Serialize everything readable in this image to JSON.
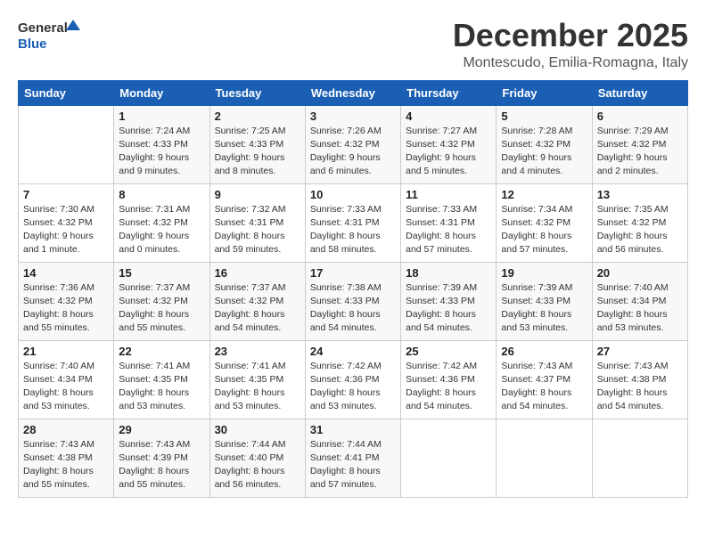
{
  "header": {
    "logo_line1": "General",
    "logo_line2": "Blue",
    "month": "December 2025",
    "location": "Montescudo, Emilia-Romagna, Italy"
  },
  "weekdays": [
    "Sunday",
    "Monday",
    "Tuesday",
    "Wednesday",
    "Thursday",
    "Friday",
    "Saturday"
  ],
  "weeks": [
    [
      {
        "day": "",
        "info": ""
      },
      {
        "day": "1",
        "info": "Sunrise: 7:24 AM\nSunset: 4:33 PM\nDaylight: 9 hours\nand 9 minutes."
      },
      {
        "day": "2",
        "info": "Sunrise: 7:25 AM\nSunset: 4:33 PM\nDaylight: 9 hours\nand 8 minutes."
      },
      {
        "day": "3",
        "info": "Sunrise: 7:26 AM\nSunset: 4:32 PM\nDaylight: 9 hours\nand 6 minutes."
      },
      {
        "day": "4",
        "info": "Sunrise: 7:27 AM\nSunset: 4:32 PM\nDaylight: 9 hours\nand 5 minutes."
      },
      {
        "day": "5",
        "info": "Sunrise: 7:28 AM\nSunset: 4:32 PM\nDaylight: 9 hours\nand 4 minutes."
      },
      {
        "day": "6",
        "info": "Sunrise: 7:29 AM\nSunset: 4:32 PM\nDaylight: 9 hours\nand 2 minutes."
      }
    ],
    [
      {
        "day": "7",
        "info": "Sunrise: 7:30 AM\nSunset: 4:32 PM\nDaylight: 9 hours\nand 1 minute."
      },
      {
        "day": "8",
        "info": "Sunrise: 7:31 AM\nSunset: 4:32 PM\nDaylight: 9 hours\nand 0 minutes."
      },
      {
        "day": "9",
        "info": "Sunrise: 7:32 AM\nSunset: 4:31 PM\nDaylight: 8 hours\nand 59 minutes."
      },
      {
        "day": "10",
        "info": "Sunrise: 7:33 AM\nSunset: 4:31 PM\nDaylight: 8 hours\nand 58 minutes."
      },
      {
        "day": "11",
        "info": "Sunrise: 7:33 AM\nSunset: 4:31 PM\nDaylight: 8 hours\nand 57 minutes."
      },
      {
        "day": "12",
        "info": "Sunrise: 7:34 AM\nSunset: 4:32 PM\nDaylight: 8 hours\nand 57 minutes."
      },
      {
        "day": "13",
        "info": "Sunrise: 7:35 AM\nSunset: 4:32 PM\nDaylight: 8 hours\nand 56 minutes."
      }
    ],
    [
      {
        "day": "14",
        "info": "Sunrise: 7:36 AM\nSunset: 4:32 PM\nDaylight: 8 hours\nand 55 minutes."
      },
      {
        "day": "15",
        "info": "Sunrise: 7:37 AM\nSunset: 4:32 PM\nDaylight: 8 hours\nand 55 minutes."
      },
      {
        "day": "16",
        "info": "Sunrise: 7:37 AM\nSunset: 4:32 PM\nDaylight: 8 hours\nand 54 minutes."
      },
      {
        "day": "17",
        "info": "Sunrise: 7:38 AM\nSunset: 4:33 PM\nDaylight: 8 hours\nand 54 minutes."
      },
      {
        "day": "18",
        "info": "Sunrise: 7:39 AM\nSunset: 4:33 PM\nDaylight: 8 hours\nand 54 minutes."
      },
      {
        "day": "19",
        "info": "Sunrise: 7:39 AM\nSunset: 4:33 PM\nDaylight: 8 hours\nand 53 minutes."
      },
      {
        "day": "20",
        "info": "Sunrise: 7:40 AM\nSunset: 4:34 PM\nDaylight: 8 hours\nand 53 minutes."
      }
    ],
    [
      {
        "day": "21",
        "info": "Sunrise: 7:40 AM\nSunset: 4:34 PM\nDaylight: 8 hours\nand 53 minutes."
      },
      {
        "day": "22",
        "info": "Sunrise: 7:41 AM\nSunset: 4:35 PM\nDaylight: 8 hours\nand 53 minutes."
      },
      {
        "day": "23",
        "info": "Sunrise: 7:41 AM\nSunset: 4:35 PM\nDaylight: 8 hours\nand 53 minutes."
      },
      {
        "day": "24",
        "info": "Sunrise: 7:42 AM\nSunset: 4:36 PM\nDaylight: 8 hours\nand 53 minutes."
      },
      {
        "day": "25",
        "info": "Sunrise: 7:42 AM\nSunset: 4:36 PM\nDaylight: 8 hours\nand 54 minutes."
      },
      {
        "day": "26",
        "info": "Sunrise: 7:43 AM\nSunset: 4:37 PM\nDaylight: 8 hours\nand 54 minutes."
      },
      {
        "day": "27",
        "info": "Sunrise: 7:43 AM\nSunset: 4:38 PM\nDaylight: 8 hours\nand 54 minutes."
      }
    ],
    [
      {
        "day": "28",
        "info": "Sunrise: 7:43 AM\nSunset: 4:38 PM\nDaylight: 8 hours\nand 55 minutes."
      },
      {
        "day": "29",
        "info": "Sunrise: 7:43 AM\nSunset: 4:39 PM\nDaylight: 8 hours\nand 55 minutes."
      },
      {
        "day": "30",
        "info": "Sunrise: 7:44 AM\nSunset: 4:40 PM\nDaylight: 8 hours\nand 56 minutes."
      },
      {
        "day": "31",
        "info": "Sunrise: 7:44 AM\nSunset: 4:41 PM\nDaylight: 8 hours\nand 57 minutes."
      },
      {
        "day": "",
        "info": ""
      },
      {
        "day": "",
        "info": ""
      },
      {
        "day": "",
        "info": ""
      }
    ]
  ]
}
